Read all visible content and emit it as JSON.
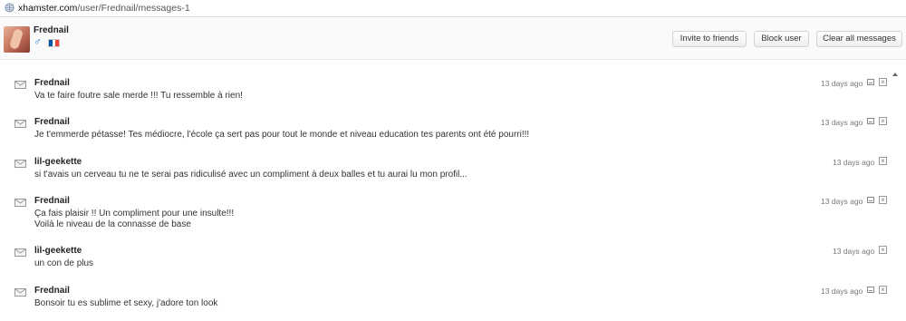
{
  "browser": {
    "url_domain": "xhamster.com",
    "url_path": "/user/Frednail/messages-1"
  },
  "profile": {
    "username": "Frednail",
    "gender_icon": "♂",
    "flag_colors": [
      "#0055a4",
      "#ffffff",
      "#ef4135"
    ]
  },
  "buttons": {
    "invite": "Invite to friends",
    "block": "Block user",
    "clear": "Clear all messages"
  },
  "messages": [
    {
      "author": "Frednail",
      "lines": [
        "Va te faire foutre sale merde !!! Tu ressemble à rien!"
      ],
      "time": "13 days ago",
      "own": true
    },
    {
      "author": "Frednail",
      "lines": [
        "Je t'emmerde pétasse! Tes médiocre, l'école ça sert pas pour tout le monde et niveau education tes parents ont été pourri!!!"
      ],
      "time": "13 days ago",
      "own": true
    },
    {
      "author": "lil-geekette",
      "lines": [
        "si t'avais un cerveau tu ne te serai pas ridiculisé avec un compliment à deux balles et tu aurai lu mon profil..."
      ],
      "time": "13 days ago",
      "own": false
    },
    {
      "author": "Frednail",
      "lines": [
        "Ça fais plaisir !! Un compliment pour une insulte!!!",
        "Voilà le niveau de la connasse de base"
      ],
      "time": "13 days ago",
      "own": true
    },
    {
      "author": "lil-geekette",
      "lines": [
        "un con de plus"
      ],
      "time": "13 days ago",
      "own": false
    },
    {
      "author": "Frednail",
      "lines": [
        "Bonsoir tu es sublime et sexy, j'adore ton look"
      ],
      "time": "13 days ago",
      "own": true
    }
  ]
}
